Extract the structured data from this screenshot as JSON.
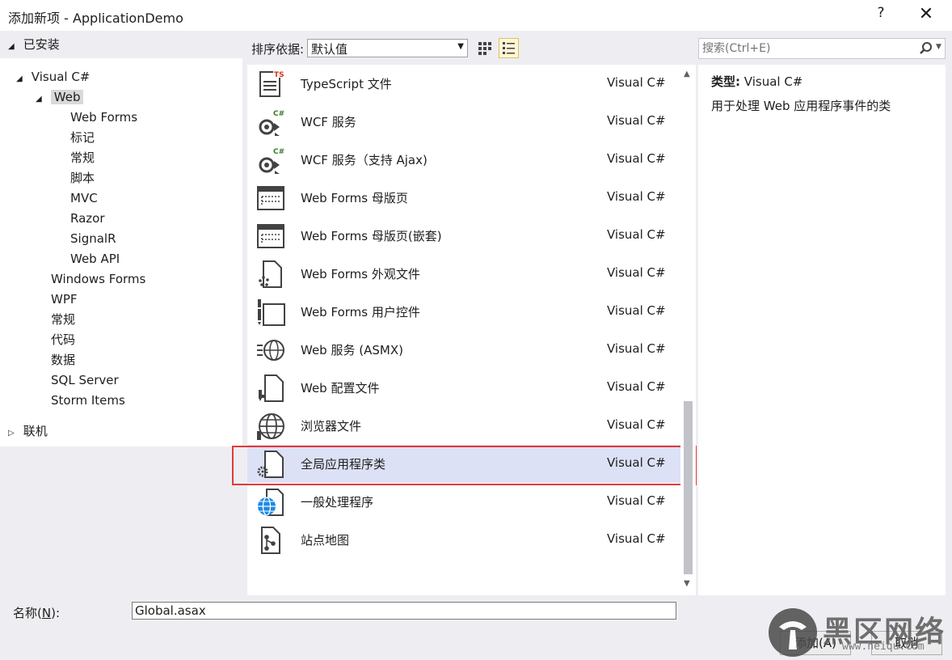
{
  "window": {
    "title": "添加新项 - ApplicationDemo",
    "help_label": "?",
    "close_label": "✕"
  },
  "tree": {
    "installed": "已安装",
    "visual_csharp": "Visual C#",
    "web": "Web",
    "web_children": [
      "Web Forms",
      "标记",
      "常规",
      "脚本",
      "MVC",
      "Razor",
      "SignalR",
      "Web API"
    ],
    "csharp_children": [
      "Windows Forms",
      "WPF",
      "常规",
      "代码",
      "数据",
      "SQL Server",
      "Storm Items"
    ],
    "online": "联机"
  },
  "toolbar": {
    "sort_label": "排序依据:",
    "sort_value": "默认值"
  },
  "search": {
    "placeholder": "搜索(Ctrl+E)"
  },
  "items": [
    {
      "name": "TypeScript 文件",
      "lang": "Visual C#",
      "icon": "typescript-file-icon"
    },
    {
      "name": "WCF 服务",
      "lang": "Visual C#",
      "icon": "wcf-service-icon"
    },
    {
      "name": "WCF 服务（支持 Ajax)",
      "lang": "Visual C#",
      "icon": "wcf-ajax-service-icon"
    },
    {
      "name": "Web Forms 母版页",
      "lang": "Visual C#",
      "icon": "master-page-icon"
    },
    {
      "name": "Web Forms 母版页(嵌套)",
      "lang": "Visual C#",
      "icon": "nested-master-page-icon"
    },
    {
      "name": "Web Forms 外观文件",
      "lang": "Visual C#",
      "icon": "skin-file-icon"
    },
    {
      "name": "Web Forms 用户控件",
      "lang": "Visual C#",
      "icon": "user-control-icon"
    },
    {
      "name": "Web 服务 (ASMX)",
      "lang": "Visual C#",
      "icon": "web-service-icon"
    },
    {
      "name": "Web 配置文件",
      "lang": "Visual C#",
      "icon": "web-config-icon"
    },
    {
      "name": "浏览器文件",
      "lang": "Visual C#",
      "icon": "browser-file-icon"
    },
    {
      "name": "全局应用程序类",
      "lang": "Visual C#",
      "icon": "global-app-class-icon"
    },
    {
      "name": "一般处理程序",
      "lang": "Visual C#",
      "icon": "generic-handler-icon"
    },
    {
      "name": "站点地图",
      "lang": "Visual C#",
      "icon": "sitemap-icon"
    }
  ],
  "details": {
    "type_label": "类型:",
    "type_value": "Visual C#",
    "description": "用于处理 Web 应用程序事件的类"
  },
  "bottom": {
    "name_label_prefix": "名称(",
    "name_label_key": "N",
    "name_label_suffix": "):",
    "name_value": "Global.asax",
    "add_button": "添加(A)",
    "cancel_button": "取消"
  },
  "watermark": {
    "text": "黑区网络",
    "url": "www.heiqu.com"
  },
  "colors": {
    "selection": "#dde1f6",
    "highlight_box": "#e5393a",
    "window_bg": "#eeeef2"
  }
}
